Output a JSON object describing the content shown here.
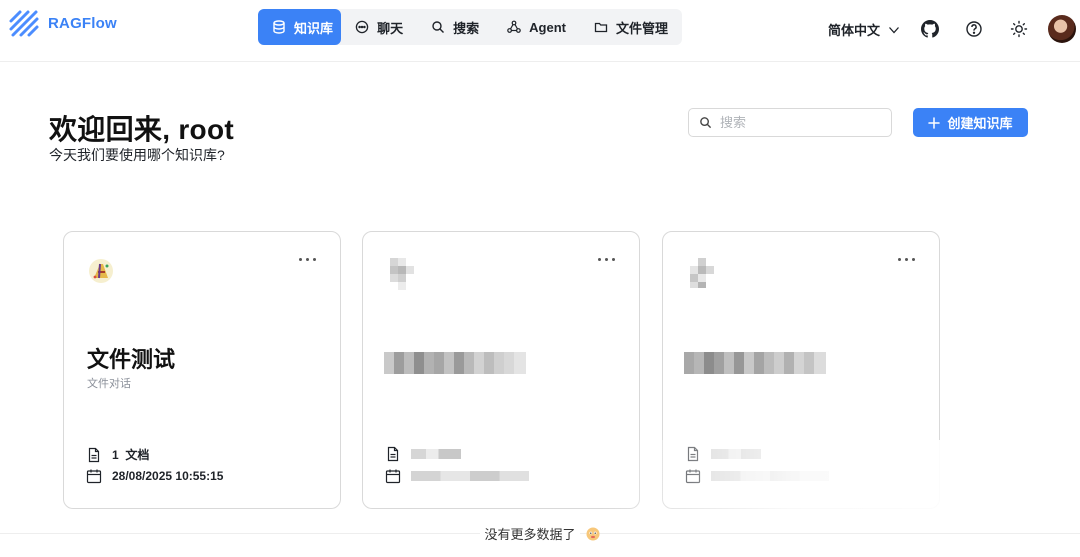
{
  "app": {
    "name": "RAGFlow",
    "brand_color": "#3b82f6"
  },
  "nav": {
    "items": [
      {
        "label": "知识库",
        "icon": "database-icon",
        "active": true
      },
      {
        "label": "聊天",
        "icon": "chat-icon"
      },
      {
        "label": "搜索",
        "icon": "search-icon"
      },
      {
        "label": "Agent",
        "icon": "agent-icon"
      },
      {
        "label": "文件管理",
        "icon": "folder-icon"
      }
    ]
  },
  "header": {
    "language": "简体中文"
  },
  "welcome": {
    "title": "欢迎回来, root",
    "subtitle": "今天我们要使用哪个知识库?"
  },
  "search": {
    "placeholder": "搜索"
  },
  "create_button": {
    "label": "创建知识库"
  },
  "cards": [
    {
      "title": "文件测试",
      "description": "文件对话",
      "doc_count": "1",
      "doc_unit": "文档",
      "updated": "28/08/2025 10:55:15"
    }
  ],
  "footer": {
    "no_more": "没有更多数据了"
  }
}
